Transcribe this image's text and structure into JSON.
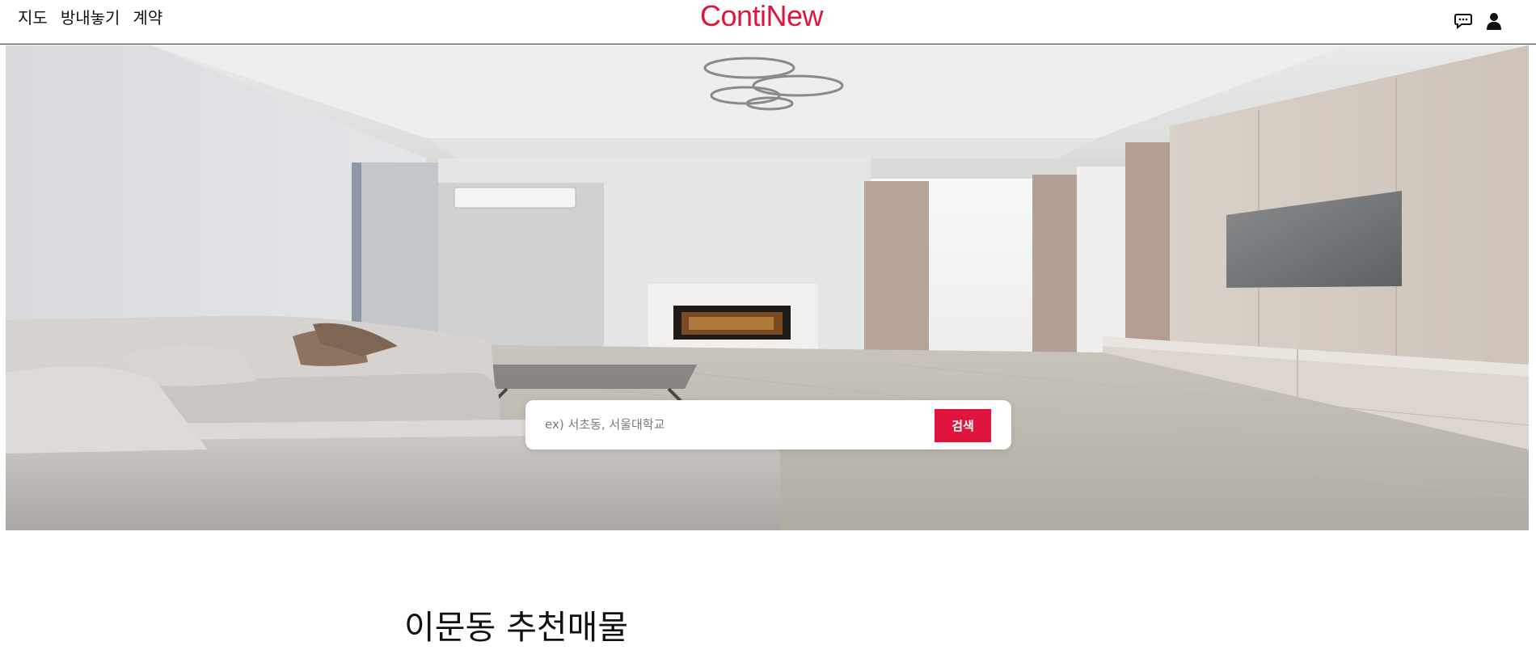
{
  "header": {
    "nav": [
      "지도",
      "방내놓기",
      "계약"
    ],
    "logo": "ContiNew",
    "icons": [
      "chat-icon",
      "user-icon"
    ]
  },
  "search": {
    "placeholder": "ex) 서초동, 서울대학교",
    "button_label": "검색"
  },
  "section": {
    "title": "이문동 추천매물"
  },
  "colors": {
    "brand": "#e0153d",
    "text": "#111111"
  }
}
